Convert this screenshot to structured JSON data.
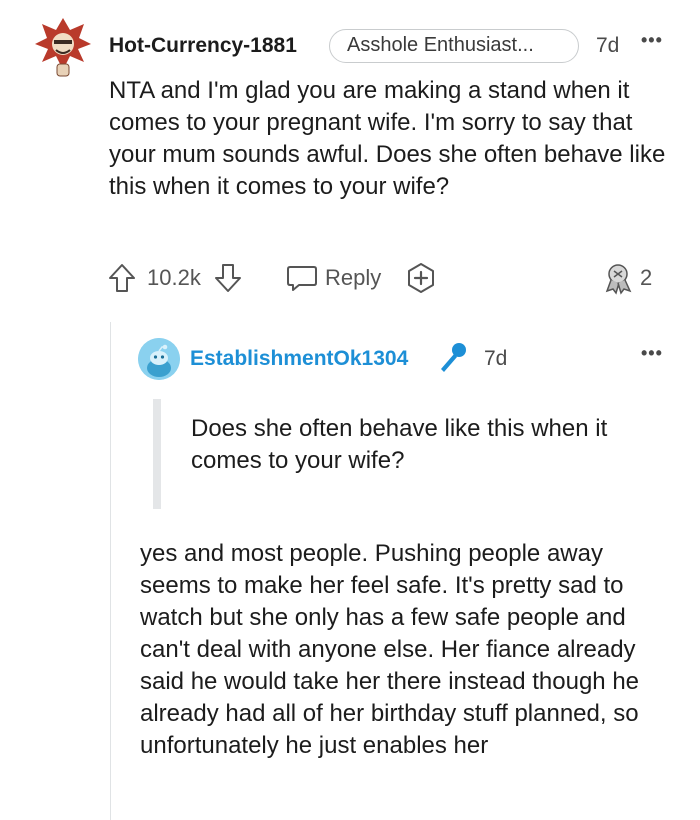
{
  "comment": {
    "username": "Hot-Currency-1881",
    "flair": "Asshole Enthusiast...",
    "time": "7d",
    "more": "•••",
    "body": "NTA and I'm glad you are making a stand when it comes to your pregnant wife. I'm sorry to say that your mum sounds awful. Does she often behave like this when it comes to your wife?",
    "actions": {
      "upvotes": "10.2k",
      "reply_label": "Reply",
      "award_count": "2"
    }
  },
  "reply": {
    "username": "EstablishmentOk1304",
    "time": "7d",
    "more": "•••",
    "quote": "Does she often behave like this when it comes to your wife?",
    "body": "yes and most people. Pushing people away seems to make her feel safe. It's pretty sad to watch but she only has a few safe people and can't deal with anyone else. Her fiance already said he would take her there instead though he already had all of her birthday stuff planned, so unfortunately he just enables her"
  },
  "icons": {
    "avatar1": "snoo-avatar-icon",
    "upvote": "upvote-arrow-icon",
    "downvote": "downvote-arrow-icon",
    "reply": "speech-bubble-icon",
    "award": "plus-award-icon",
    "awards_given": "award-badge-icon",
    "avatar2": "default-snoo-avatar-icon",
    "mic": "microphone-icon"
  },
  "colors": {
    "username_link": "#1d8fd6",
    "avatar2_bg": "#8ad1ef",
    "text": "#1c1c1c",
    "meta": "#555555"
  }
}
